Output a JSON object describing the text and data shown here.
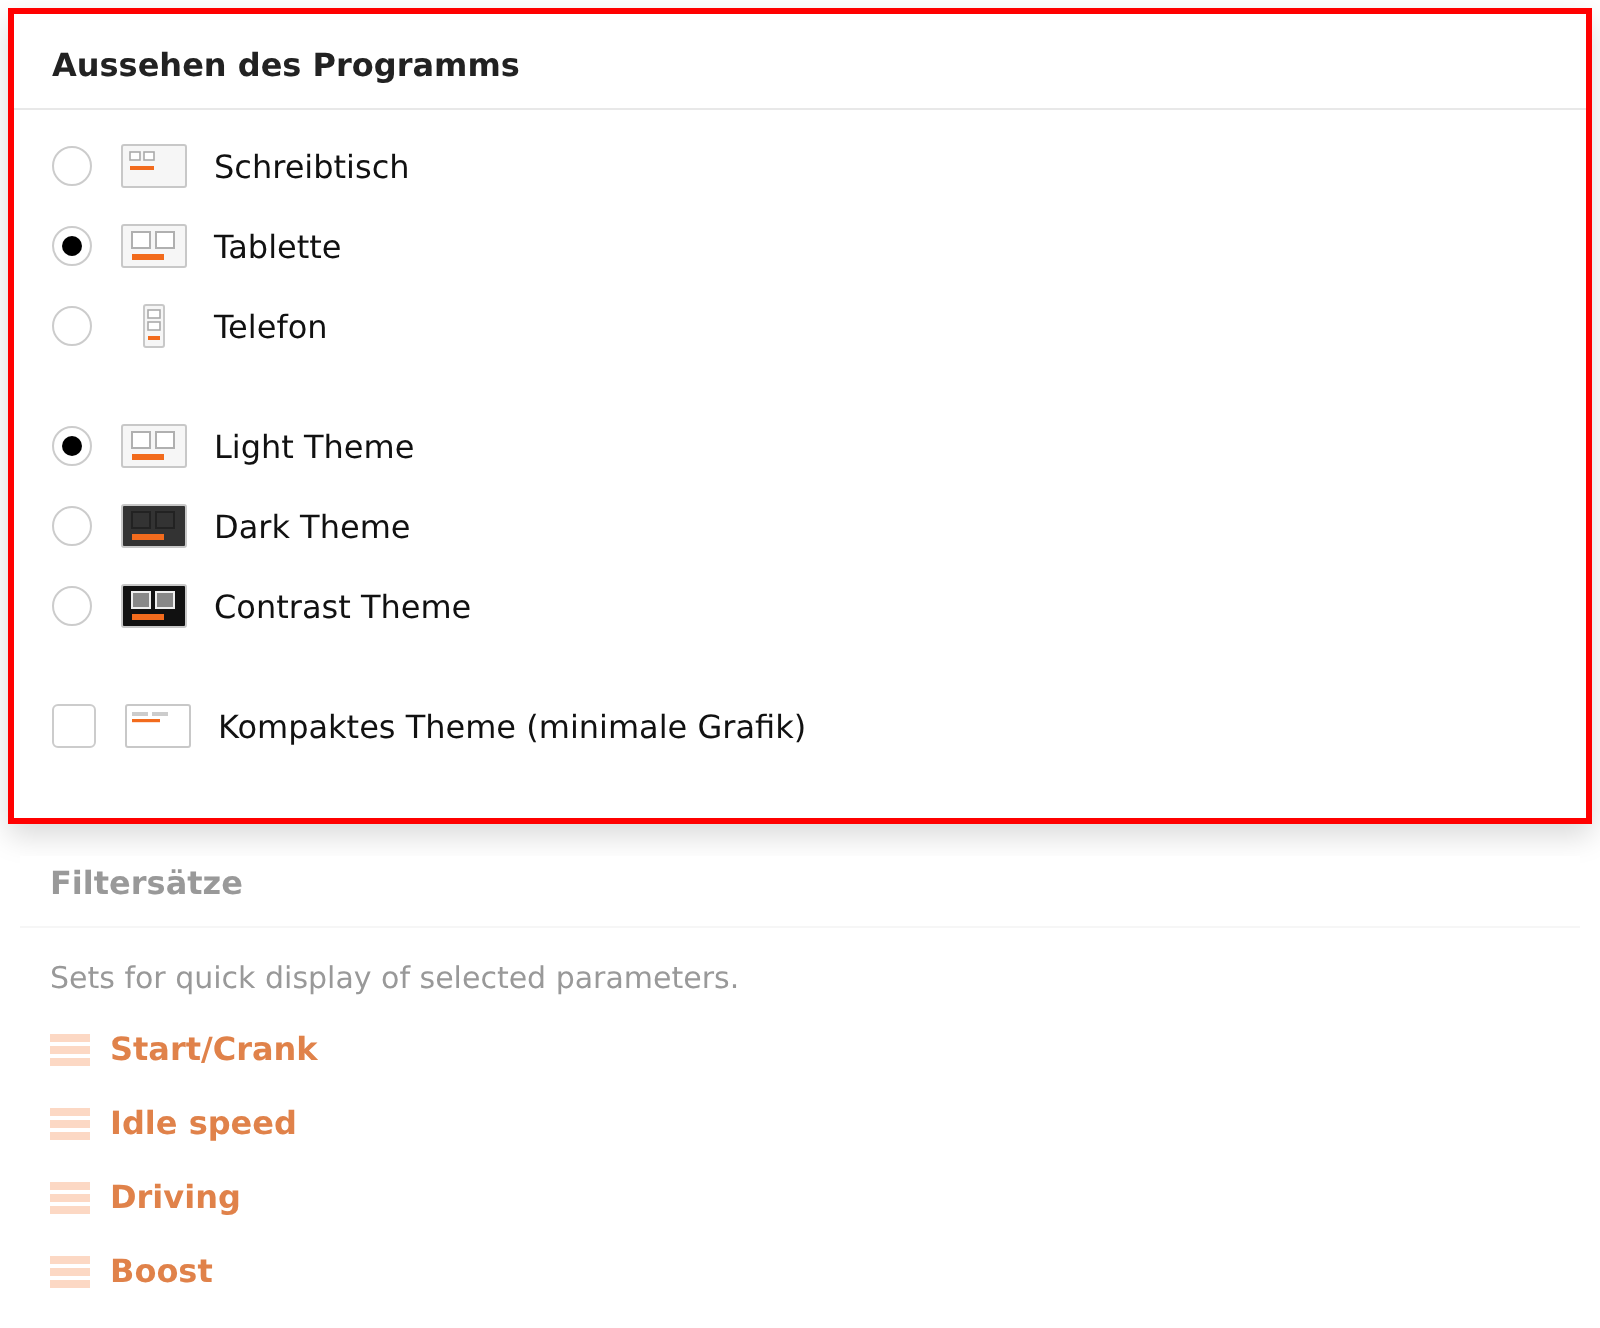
{
  "panel": {
    "title": "Aussehen des Programms",
    "layout_options": [
      {
        "label": "Schreibtisch",
        "kind": "desktop",
        "selected": false
      },
      {
        "label": "Tablette",
        "kind": "tablet",
        "selected": true
      },
      {
        "label": "Telefon",
        "kind": "phone",
        "selected": false
      }
    ],
    "theme_options": [
      {
        "label": "Light Theme",
        "kind": "light",
        "selected": true
      },
      {
        "label": "Dark Theme",
        "kind": "dark",
        "selected": false
      },
      {
        "label": "Contrast Theme",
        "kind": "contrast",
        "selected": false
      }
    ],
    "compact": {
      "label": "Kompaktes Theme (minimale Grafik)",
      "kind": "compact",
      "checked": false
    }
  },
  "filter_sets": {
    "title": "Filtersätze",
    "description": "Sets for quick display of selected parameters.",
    "items": [
      "Start/Crank",
      "Idle speed",
      "Driving",
      "Boost"
    ]
  }
}
